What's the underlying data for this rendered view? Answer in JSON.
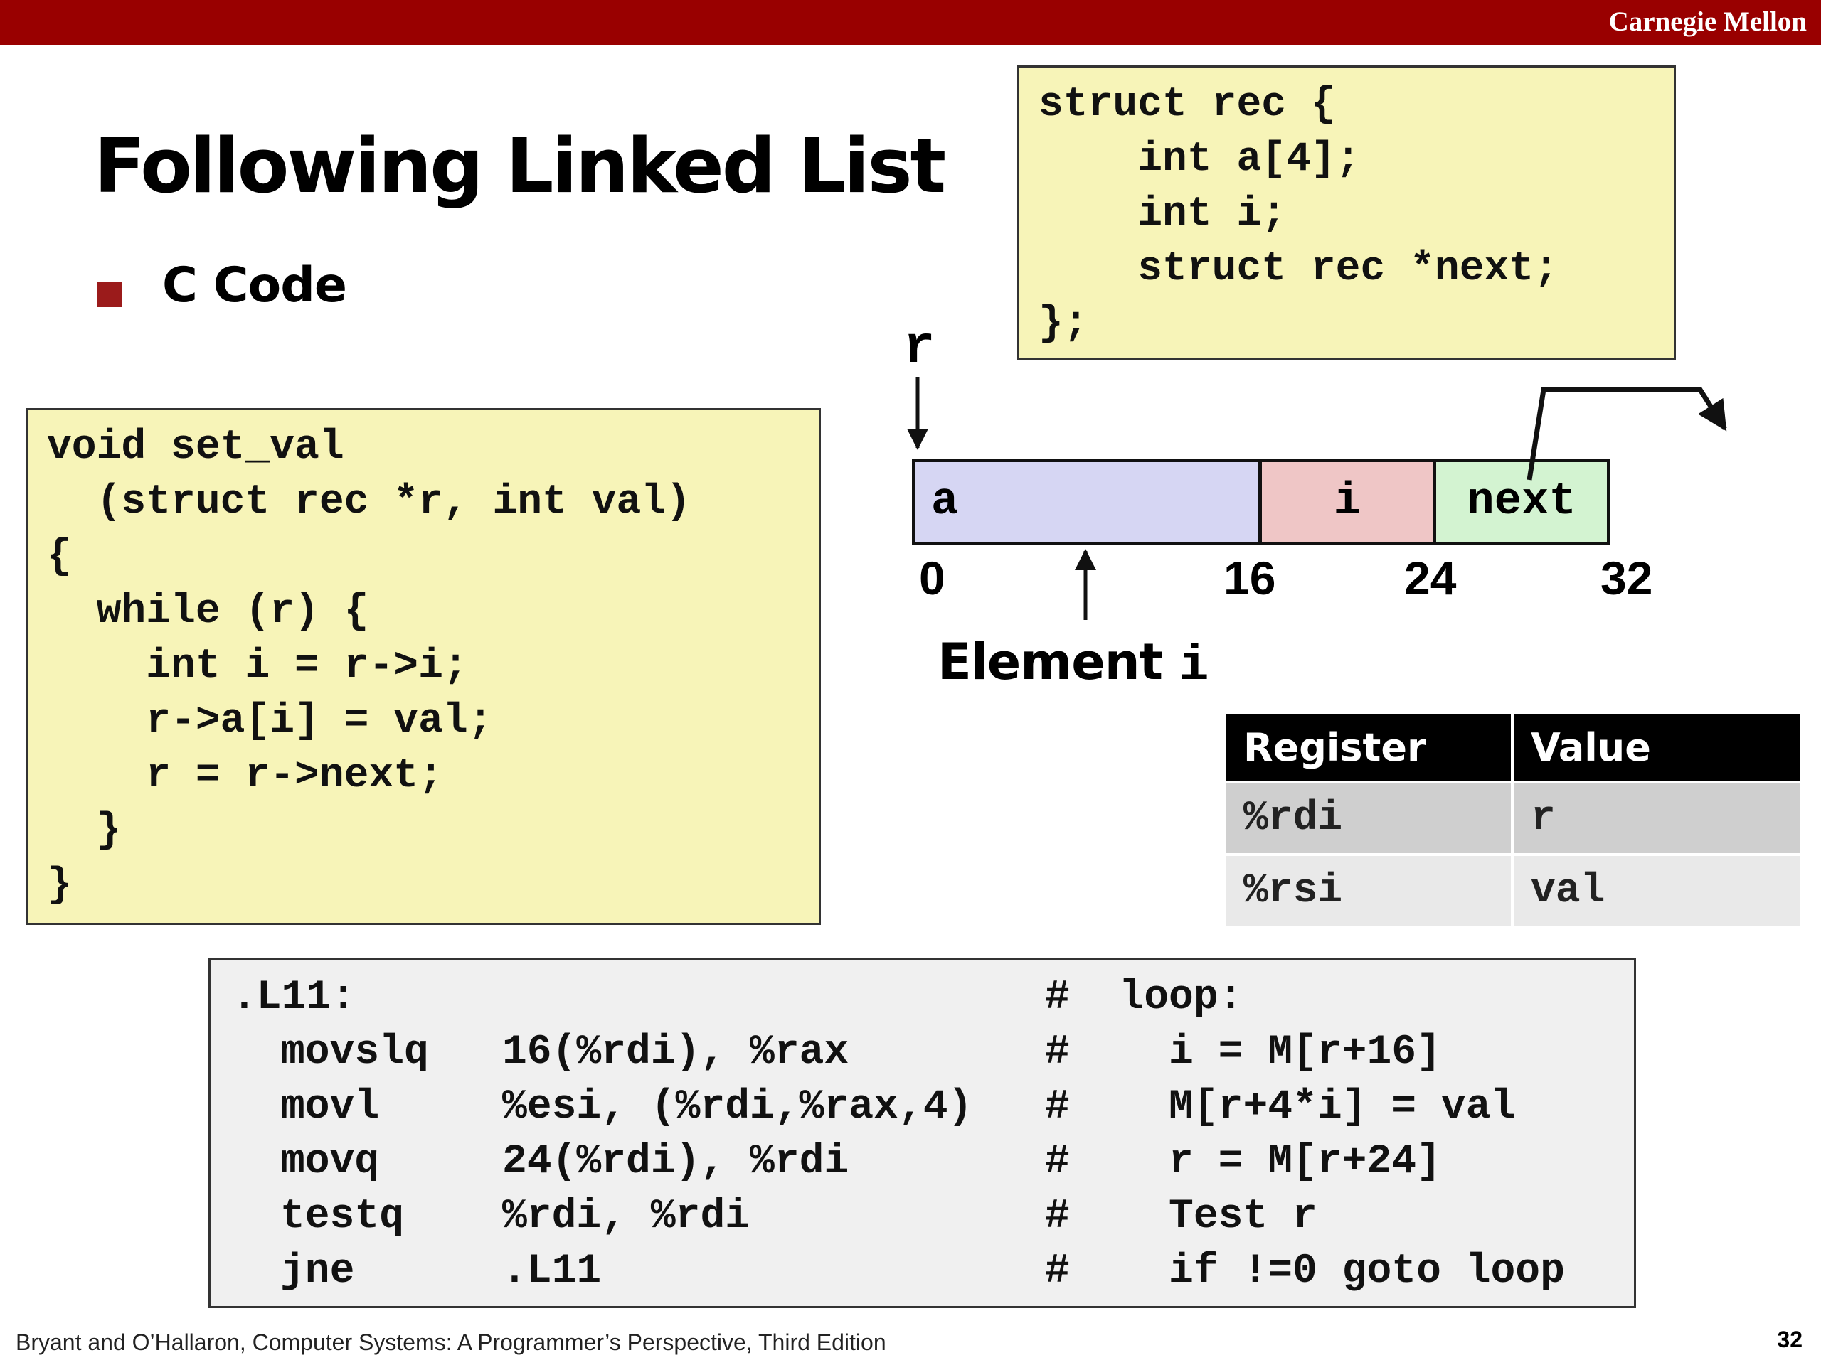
{
  "header": {
    "brand": "Carnegie Mellon"
  },
  "slide": {
    "title": "Following Linked List",
    "bullet": "C Code"
  },
  "struct_code": "struct rec {\n    int a[4];\n    int i;\n    struct rec *next;\n};",
  "function_code": "void set_val\n  (struct rec *r, int val)\n{\n  while (r) {\n    int i = r->i;\n    r->a[i] = val;\n    r = r->next;\n  }\n}",
  "memory_diagram": {
    "pointer_label": "r",
    "fields": [
      "a",
      "i",
      "next"
    ],
    "offsets": [
      "0",
      "16",
      "24",
      "32"
    ],
    "element_label_prefix": "Element ",
    "element_label_var": "i"
  },
  "register_table": {
    "headers": [
      "Register",
      "Value"
    ],
    "rows": [
      {
        "register": "%rdi",
        "value": "r"
      },
      {
        "register": "%rsi",
        "value": "val"
      }
    ]
  },
  "assembly": {
    "label": ".L11:",
    "label_comment": "#  loop:",
    "lines": [
      {
        "op": "movslq",
        "args": "16(%rdi), %rax",
        "comment": "#    i = M[r+16]"
      },
      {
        "op": "movl",
        "args": "%esi, (%rdi,%rax,4)",
        "comment": "#    M[r+4*i] = val"
      },
      {
        "op": "movq",
        "args": "24(%rdi), %rdi",
        "comment": "#    r = M[r+24]"
      },
      {
        "op": "testq",
        "args": "%rdi, %rdi",
        "comment": "#    Test r"
      },
      {
        "op": "jne",
        "args": ".L11",
        "comment": "#    if !=0 goto loop"
      }
    ]
  },
  "footer": {
    "citation": "Bryant and O’Hallaron, Computer Systems: A Programmer’s Perspective, Third Edition",
    "page": "32"
  }
}
